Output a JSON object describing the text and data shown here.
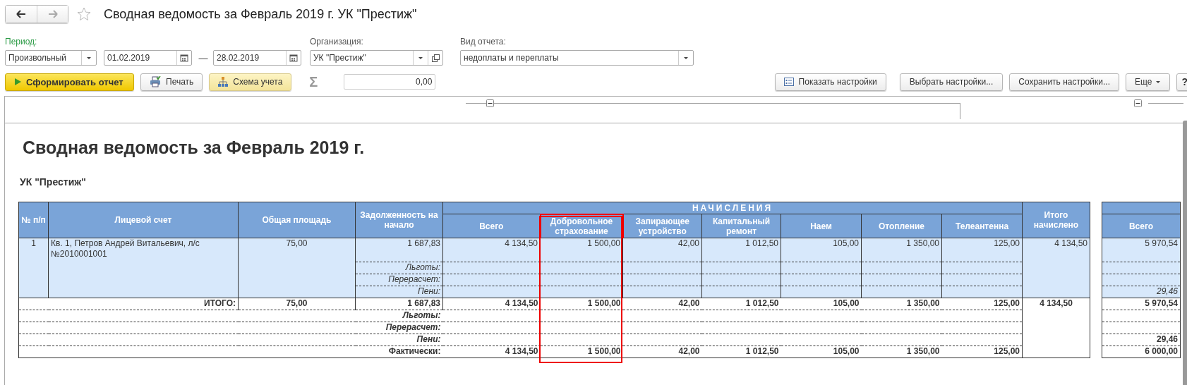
{
  "window": {
    "title": "Сводная ведомость за Февраль 2019 г. УК \"Престиж\""
  },
  "filters": {
    "period_label": "Период:",
    "period_type": "Произвольный",
    "date_from": "01.02.2019",
    "dash": "—",
    "date_to": "28.02.2019",
    "org_label": "Организация:",
    "org": "УК \"Престиж\"",
    "report_type_label": "Вид отчета:",
    "report_type": "недоплаты и переплаты"
  },
  "toolbar": {
    "generate": "Сформировать отчет",
    "print": "Печать",
    "scheme": "Схема учета",
    "sigma": "Σ",
    "sum": "0,00",
    "show_settings": "Показать настройки",
    "choose_settings": "Выбрать настройки...",
    "save_settings": "Сохранить настройки...",
    "more": "Еще",
    "help": "?"
  },
  "report": {
    "title": "Сводная ведомость за Февраль 2019 г.",
    "org": "УК \"Престиж\"",
    "table": {
      "group_label": "НАЧИСЛЕНИЯ",
      "columns": [
        {
          "label": "№ п/п",
          "grouped": false,
          "highlighted": false
        },
        {
          "label": "Лицевой счет",
          "grouped": false,
          "highlighted": false
        },
        {
          "label": "Общая площадь",
          "grouped": false,
          "highlighted": false
        },
        {
          "label": "Задолженность на начало",
          "grouped": false,
          "highlighted": false
        },
        {
          "label": "Всего",
          "grouped": true,
          "highlighted": false
        },
        {
          "label": "Добровольное страхование",
          "grouped": true,
          "highlighted": true
        },
        {
          "label": "Запирающее устройство",
          "grouped": true,
          "highlighted": false
        },
        {
          "label": "Капитальный ремонт",
          "grouped": true,
          "highlighted": false
        },
        {
          "label": "Наем",
          "grouped": true,
          "highlighted": false
        },
        {
          "label": "Отопление",
          "grouped": true,
          "highlighted": false
        },
        {
          "label": "Телеантенна",
          "grouped": true,
          "highlighted": false
        },
        {
          "label": "Итого начислено",
          "grouped": false,
          "highlighted": false
        }
      ],
      "accounts": [
        {
          "num": "1",
          "account": "Кв. 1, Петров Андрей Витальевич, л/с №2010001001",
          "area": "75,00",
          "values": [
            "1 687,83",
            "4 134,50",
            "1 500,00",
            "42,00",
            "1 012,50",
            "105,00",
            "1 350,00",
            "125,00"
          ],
          "sub_rows": [
            "Льготы:",
            "Перерасчет:",
            "Пени:"
          ],
          "total_charged": "4 134,50"
        }
      ],
      "totals": {
        "total_charged": "4 134,50",
        "rows": [
          {
            "kind": "total",
            "label": "ИТОГО:",
            "area": "75,00",
            "values": [
              "1 687,83",
              "4 134,50",
              "1 500,00",
              "42,00",
              "1 012,50",
              "105,00",
              "1 350,00",
              "125,00"
            ]
          },
          {
            "kind": "adjustment",
            "label": "Льготы:"
          },
          {
            "kind": "adjustment",
            "label": "Перерасчет:"
          },
          {
            "kind": "adjustment",
            "label": "Пени:"
          },
          {
            "kind": "actual",
            "label": "Фактически:",
            "values": [
              "4 134,50",
              "1 500,00",
              "42,00",
              "1 012,50",
              "105,00",
              "1 350,00",
              "125,00"
            ]
          }
        ]
      }
    },
    "side_table": {
      "column": "Всего",
      "account_rows": [
        {
          "kind": "main",
          "value": "5 970,54"
        },
        {
          "kind": "blank"
        },
        {
          "kind": "blank"
        },
        {
          "kind": "penalty",
          "value": "29,46"
        }
      ],
      "total_rows": [
        {
          "kind": "total",
          "value": "5 970,54"
        },
        {
          "kind": "blank"
        },
        {
          "kind": "blank"
        },
        {
          "kind": "total",
          "value": "29,46"
        },
        {
          "kind": "total",
          "value": "6 000,00"
        }
      ]
    }
  }
}
